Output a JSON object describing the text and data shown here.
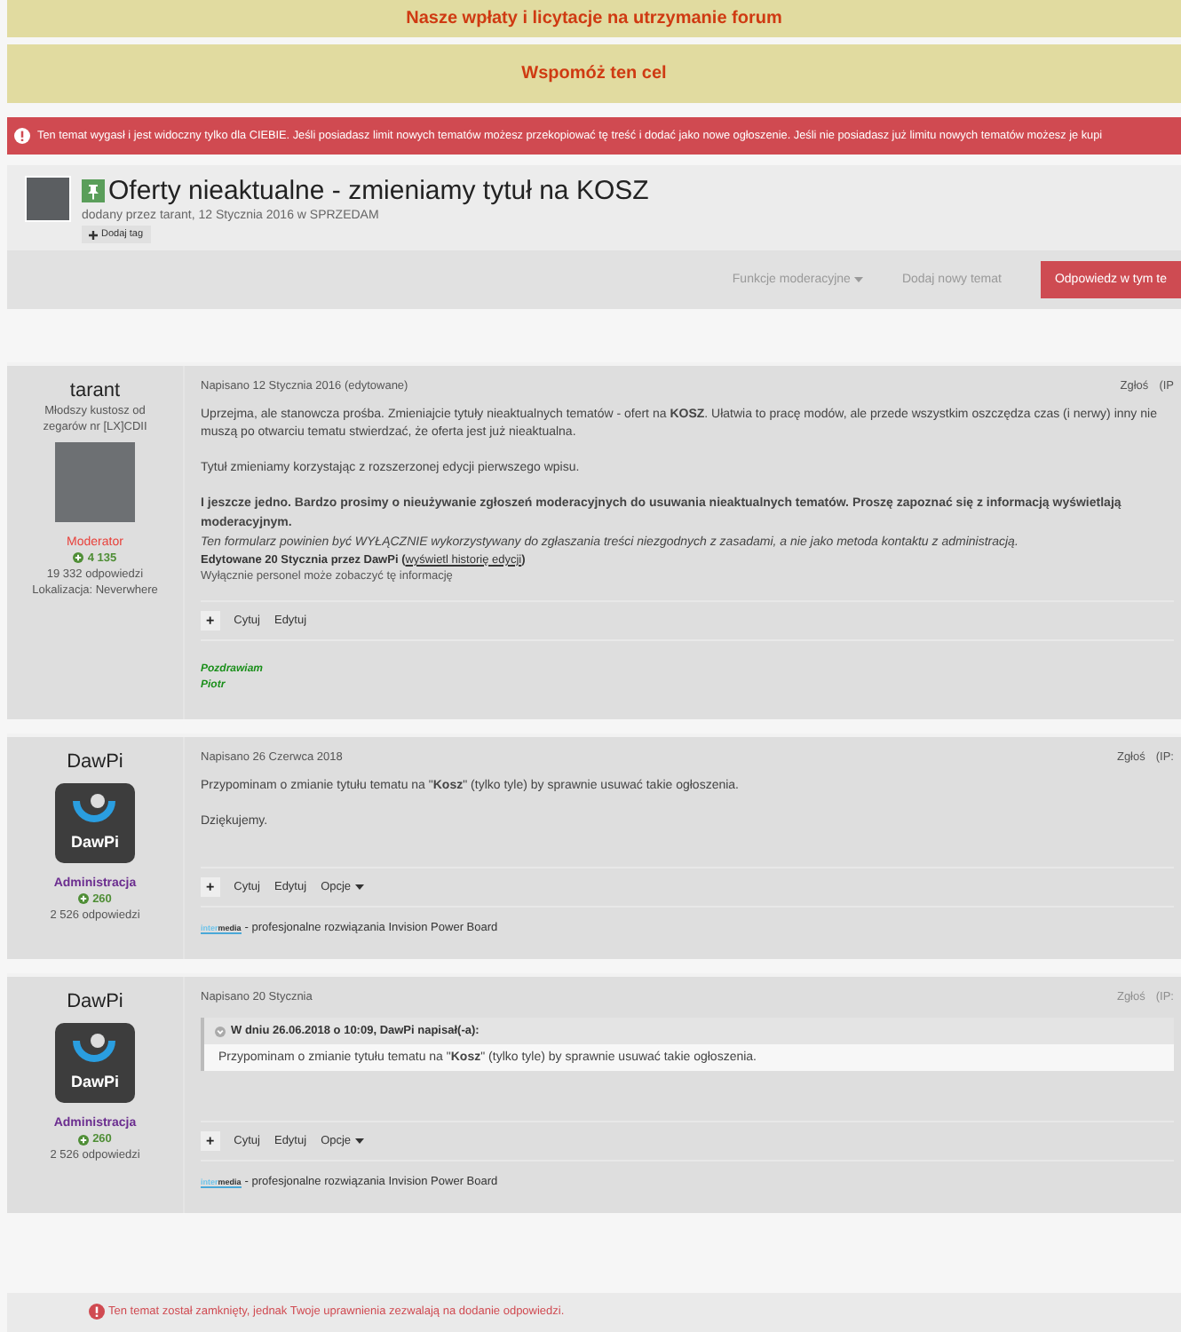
{
  "banners": [
    "Nasze wpłaty i licytacje na utrzymanie forum",
    "Wspomóż ten cel"
  ],
  "expired_alert": "Ten temat wygasł i jest widoczny tylko dla CIEBIE. Jeśli posiadasz limit nowych tematów możesz przekopiować tę treść i dodać jako nowe ogłoszenie. Jeśli nie posiadasz już limitu nowych tematów możesz je kupi",
  "topic": {
    "pinned": true,
    "title": "Oferty nieaktualne - zmieniamy tytuł na KOSZ",
    "meta": "dodany przez tarant, 12 Stycznia 2016 w SPRZEDAM",
    "tag_button": "Dodaj tag"
  },
  "toolbar": {
    "moderation": "Funkcje moderacyjne",
    "new_topic": "Dodaj nowy temat",
    "reply": "Odpowiedz w tym te"
  },
  "posts": [
    {
      "author": {
        "name": "tarant",
        "rank": "Młodszy kustosz od zegarów nr [LX]CDII",
        "avatar": {
          "kind": "photo"
        },
        "role": "Moderator",
        "color": "#e8403a",
        "reputation": "4 135",
        "replies": "19 332 odpowiedzi",
        "location": "Lokalizacja: Neverwhere"
      },
      "date": "Napisano 12 Stycznia 2016 (edytowane)",
      "report": "Zgłoś",
      "ip": "(IP",
      "report_disabled": false,
      "body": [
        {
          "kind": "text",
          "text": "Uprzejma, ale stanowcza prośba. Zmieniajcie tytuły nieaktualnych tematów - ofert na **KOSZ**. Ułatwia to pracę modów, ale przede wszystkim oszczędza czas (i nerwy) inny nie muszą  po otwarciu tematu stwierdzać, że oferta jest już nieaktualna."
        },
        {
          "kind": "text",
          "text": "Tytuł zmieniamy korzystając z rozszerzonej edycji pierwszego wpisu."
        },
        {
          "kind": "bold",
          "text": "I jeszcze jedno. Bardzo prosimy o nieużywanie zgłoszeń moderacyjnych do usuwania nieaktualnych tematów. Proszę zapoznać się z informacją wyświetlają moderacyjnym."
        },
        {
          "kind": "italic",
          "text": "Ten formularz powinien być WYŁĄCZNIE wykorzystywany do zgłaszania treści niezgodnych z zasadami, a nie jako metoda kontaktu z administracją."
        },
        {
          "kind": "edited",
          "text": "Edytowane 20 Stycznia przez DawPi (",
          "link": "wyświetl historię edycji",
          "after": ")"
        },
        {
          "kind": "note",
          "text": "Wyłącznie personel może zobaczyć tę informację"
        }
      ],
      "plus": "+",
      "actions": [
        {
          "label": "Cytuj",
          "kind": "plain"
        },
        {
          "label": "Edytuj",
          "kind": "plain"
        }
      ],
      "signature": {
        "kind": "green",
        "lines": [
          "Pozdrawiam",
          "Piotr"
        ]
      }
    },
    {
      "author": {
        "name": "DawPi",
        "avatar": {
          "kind": "logo",
          "label": "DawPi"
        },
        "role": "Administracja",
        "color": "#6b2d8f",
        "reputation": "260",
        "replies": "2 526 odpowiedzi"
      },
      "date": "Napisano 26 Czerwca 2018",
      "report": "Zgłoś",
      "ip": "(IP:",
      "report_disabled": false,
      "body": [
        {
          "kind": "text",
          "text": "Przypominam o zmianie tytułu tematu na \"**Kosz**\" (tylko tyle) by sprawnie usuwać takie ogłoszenia."
        },
        {
          "kind": "text",
          "text": "Dziękujemy."
        }
      ],
      "plus": "+",
      "actions": [
        {
          "label": "Cytuj",
          "kind": "plain"
        },
        {
          "label": "Edytuj",
          "kind": "plain"
        },
        {
          "label": "Opcje",
          "kind": "menu"
        }
      ],
      "signature": {
        "kind": "logo",
        "logo_a": "inter",
        "logo_b": "media",
        "text": "- profesjonalne rozwiązania Invision Power Board"
      }
    },
    {
      "author": {
        "name": "DawPi",
        "avatar": {
          "kind": "logo",
          "label": "DawPi"
        },
        "role": "Administracja",
        "color": "#6b2d8f",
        "reputation": "260",
        "replies": "2 526 odpowiedzi"
      },
      "date": "Napisano 20 Stycznia",
      "report": "Zgłoś",
      "ip": "(IP:",
      "report_disabled": true,
      "body": [
        {
          "kind": "quote",
          "header": "W dniu 26.06.2018 o 10:09, DawPi napisał(-a):",
          "text": "Przypominam o zmianie tytułu tematu na \"**Kosz**\" (tylko tyle) by sprawnie usuwać takie ogłoszenia."
        }
      ],
      "plus": "+",
      "actions": [
        {
          "label": "Cytuj",
          "kind": "plain"
        },
        {
          "label": "Edytuj",
          "kind": "plain"
        },
        {
          "label": "Opcje",
          "kind": "menu"
        }
      ],
      "signature": {
        "kind": "logo",
        "logo_a": "inter",
        "logo_b": "media",
        "text": "- profesjonalne rozwiązania Invision Power Board"
      }
    }
  ],
  "closed_notice": "Ten temat został zamknięty, jednak Twoje uprawnienia zezwalają na dodanie odpowiedzi."
}
